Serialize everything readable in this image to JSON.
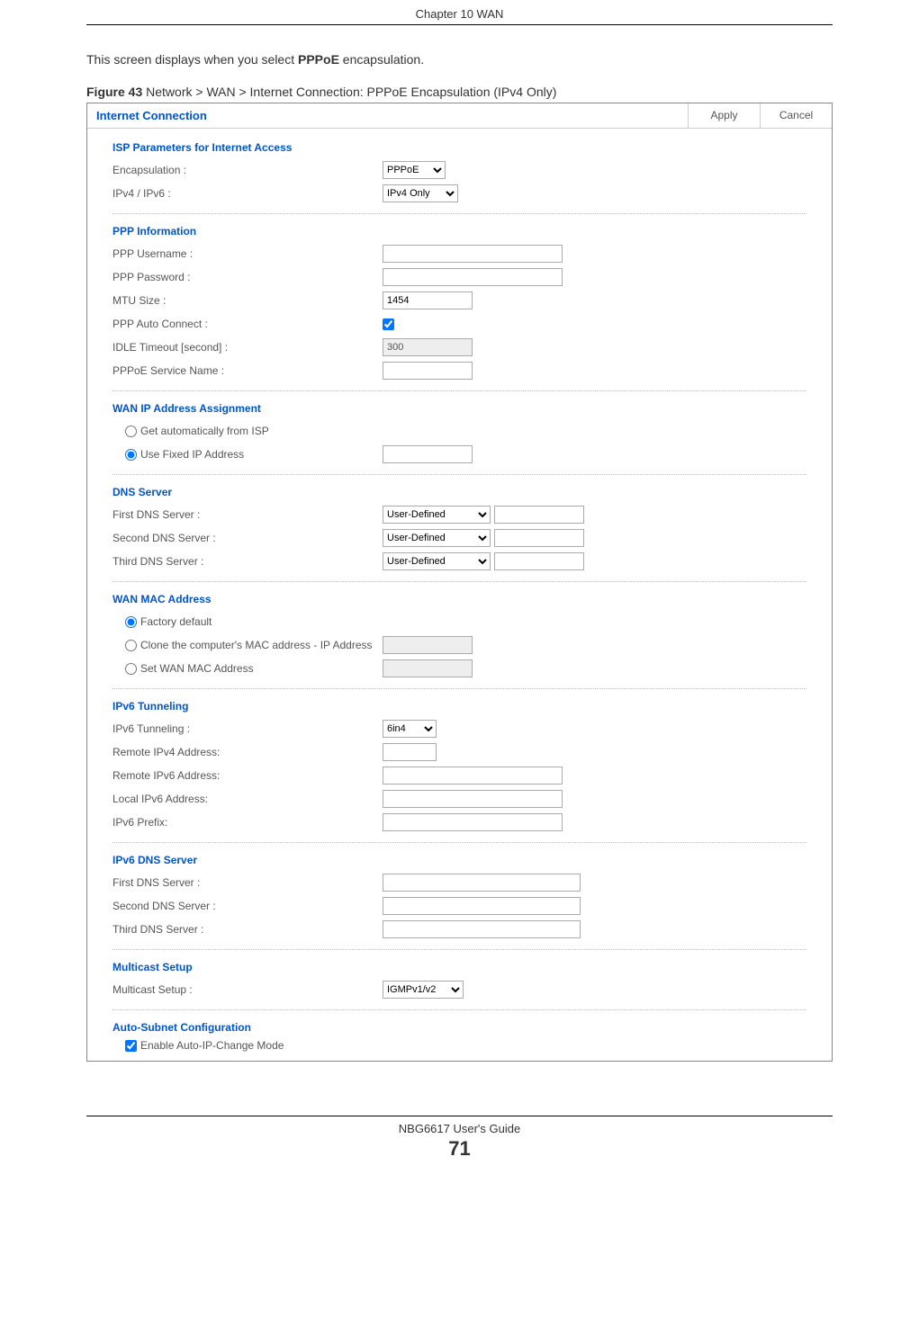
{
  "chapter_header": "Chapter 10 WAN",
  "intro_pre": "This screen displays when you select ",
  "intro_bold": "PPPoE",
  "intro_post": " encapsulation.",
  "figure_label": "Figure 43",
  "figure_caption": "   Network > WAN > Internet Connection: PPPoE Encapsulation (IPv4 Only)",
  "header": {
    "title": "Internet Connection",
    "apply": "Apply",
    "cancel": "Cancel"
  },
  "isp": {
    "title": "ISP Parameters for Internet Access",
    "encap_label": "Encapsulation :",
    "encap_value": "PPPoE",
    "ipver_label": "IPv4 / IPv6 :",
    "ipver_value": "IPv4 Only"
  },
  "ppp": {
    "title": "PPP Information",
    "user_label": "PPP Username :",
    "user_value": "",
    "pass_label": "PPP Password :",
    "pass_value": "",
    "mtu_label": "MTU Size :",
    "mtu_value": "1454",
    "auto_label": "PPP Auto Connect :",
    "idle_label": "IDLE Timeout [second] :",
    "idle_value": "300",
    "svc_label": "PPPoE Service Name :",
    "svc_value": ""
  },
  "wanip": {
    "title": "WAN IP Address Assignment",
    "auto_label": "Get automatically from ISP",
    "fixed_label": "Use Fixed IP Address",
    "fixed_value": ""
  },
  "dns": {
    "title": "DNS Server",
    "first_label": "First DNS Server :",
    "second_label": "Second DNS Server :",
    "third_label": "Third DNS Server :",
    "mode": "User-Defined",
    "val1": "",
    "val2": "",
    "val3": ""
  },
  "mac": {
    "title": "WAN MAC Address",
    "factory_label": "Factory default",
    "clone_label": "Clone the computer's MAC address - IP Address",
    "clone_value": "",
    "set_label": "Set WAN MAC Address",
    "set_value": ""
  },
  "v6tun": {
    "title": "IPv6 Tunneling",
    "tun_label": "IPv6 Tunneling :",
    "tun_value": "6in4",
    "rem4_label": "Remote IPv4 Address:",
    "rem4_value": "",
    "rem6_label": "Remote IPv6 Address:",
    "rem6_value": "",
    "loc6_label": "Local IPv6 Address:",
    "loc6_value": "",
    "pref_label": "IPv6 Prefix:",
    "pref_value": ""
  },
  "v6dns": {
    "title": "IPv6 DNS Server",
    "first_label": "First DNS Server :",
    "second_label": "Second DNS Server :",
    "third_label": "Third DNS Server :",
    "val1": "",
    "val2": "",
    "val3": ""
  },
  "mcast": {
    "title": "Multicast Setup",
    "label": "Multicast Setup :",
    "value": "IGMPv1/v2"
  },
  "autosub": {
    "title": "Auto-Subnet Configuration",
    "label": "Enable Auto-IP-Change Mode"
  },
  "footer": {
    "guide": "NBG6617 User's Guide",
    "page": "71"
  }
}
